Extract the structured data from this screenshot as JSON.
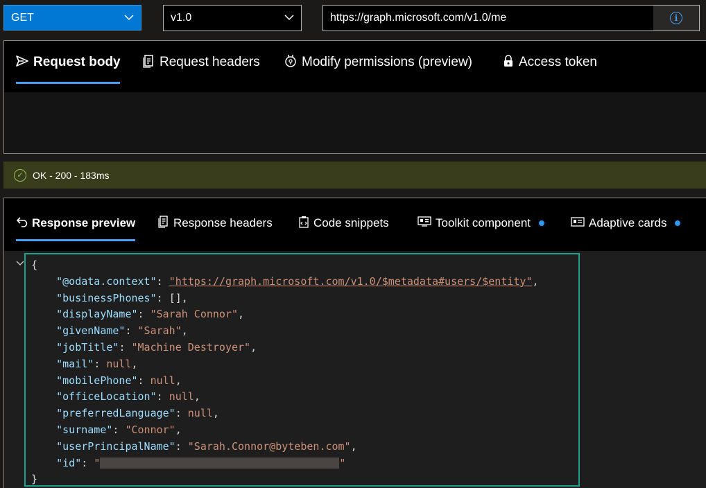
{
  "toolbar": {
    "method": "GET",
    "version": "v1.0",
    "url": "https://graph.microsoft.com/v1.0/me",
    "info_icon": "info-icon"
  },
  "request_tabs": [
    {
      "label": "Request body",
      "icon": "send-icon",
      "active": true
    },
    {
      "label": "Request headers",
      "icon": "document-icon",
      "active": false
    },
    {
      "label": "Modify permissions (preview)",
      "icon": "permissions-icon",
      "active": false
    },
    {
      "label": "Access token",
      "icon": "lock-icon",
      "active": false
    }
  ],
  "status": {
    "text": "OK - 200 - 183ms",
    "icon": "check-circle-icon",
    "color": "#92c353"
  },
  "response_tabs": [
    {
      "label": "Response preview",
      "icon": "undo-arrow-icon",
      "active": true,
      "dot": false
    },
    {
      "label": "Response headers",
      "icon": "document-icon",
      "active": false,
      "dot": false
    },
    {
      "label": "Code snippets",
      "icon": "code-clipboard-icon",
      "active": false,
      "dot": false
    },
    {
      "label": "Toolkit component",
      "icon": "toolkit-icon",
      "active": false,
      "dot": true
    },
    {
      "label": "Adaptive cards",
      "icon": "card-icon",
      "active": false,
      "dot": true
    }
  ],
  "response_json": {
    "open_brace": "{",
    "close_brace": "}",
    "lines": [
      {
        "key": "\"@odata.context\"",
        "value": "\"https://graph.microsoft.com/v1.0/$metadata#users/$entity\"",
        "type": "link",
        "comma": ","
      },
      {
        "key": "\"businessPhones\"",
        "value": "[]",
        "type": "plain",
        "comma": ","
      },
      {
        "key": "\"displayName\"",
        "value": "\"Sarah Connor\"",
        "type": "string",
        "comma": ","
      },
      {
        "key": "\"givenName\"",
        "value": "\"Sarah\"",
        "type": "string",
        "comma": ","
      },
      {
        "key": "\"jobTitle\"",
        "value": "\"Machine Destroyer\"",
        "type": "string",
        "comma": ","
      },
      {
        "key": "\"mail\"",
        "value": "null",
        "type": "null",
        "comma": ","
      },
      {
        "key": "\"mobilePhone\"",
        "value": "null",
        "type": "null",
        "comma": ","
      },
      {
        "key": "\"officeLocation\"",
        "value": "null",
        "type": "null",
        "comma": ","
      },
      {
        "key": "\"preferredLanguage\"",
        "value": "null",
        "type": "null",
        "comma": ","
      },
      {
        "key": "\"surname\"",
        "value": "\"Connor\"",
        "type": "string",
        "comma": ","
      },
      {
        "key": "\"userPrincipalName\"",
        "value": "\"Sarah.Connor@byteben.com\"",
        "type": "string",
        "comma": ","
      },
      {
        "key": "\"id\"",
        "value": "\"",
        "type": "redacted",
        "comma": ""
      }
    ]
  },
  "colors": {
    "accent": "#0078d4",
    "tab_underline": "#479ef5",
    "status_bg": "#393d1b",
    "highlight_border": "#1aa38a"
  }
}
